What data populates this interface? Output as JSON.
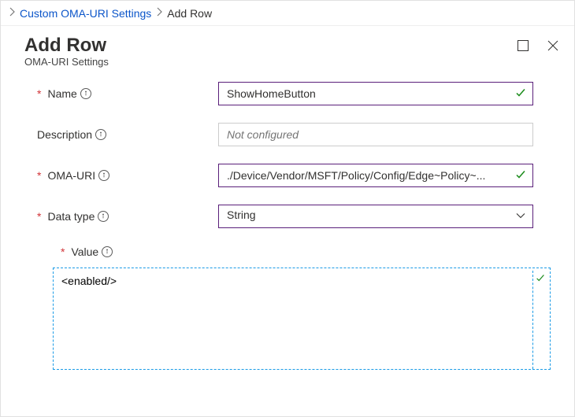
{
  "breadcrumb": {
    "parent": "Custom OMA-URI Settings",
    "current": "Add Row"
  },
  "pane": {
    "title": "Add Row",
    "subtitle": "OMA-URI Settings"
  },
  "fields": {
    "name": {
      "label": "Name",
      "value": "ShowHomeButton",
      "required": true
    },
    "description": {
      "label": "Description",
      "placeholder": "Not configured",
      "value": "",
      "required": false
    },
    "omaUri": {
      "label": "OMA-URI",
      "value": "./Device/Vendor/MSFT/Policy/Config/Edge~Policy~...",
      "required": true
    },
    "dataType": {
      "label": "Data type",
      "value": "String",
      "required": true
    },
    "value": {
      "label": "Value",
      "text": "<enabled/>",
      "required": true
    }
  }
}
